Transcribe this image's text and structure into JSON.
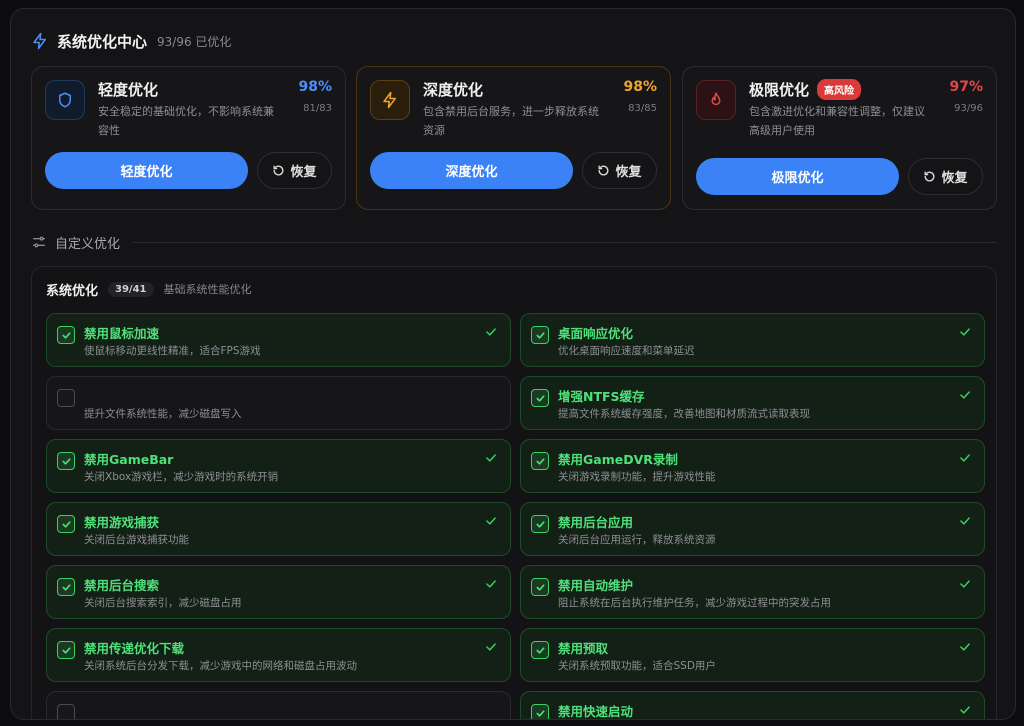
{
  "header": {
    "title": "系统优化中心",
    "status": "93/96 已优化"
  },
  "cards": [
    {
      "title": "轻度优化",
      "badge": "",
      "desc": "安全稳定的基础优化，不影响系统兼容性",
      "percent": "98%",
      "count": "81/83",
      "action": "轻度优化",
      "restore": "恢复",
      "accent": "#4c8ef7",
      "icon": "shield-icon"
    },
    {
      "title": "深度优化",
      "badge": "",
      "desc": "包含禁用后台服务，进一步释放系统资源",
      "percent": "98%",
      "count": "83/85",
      "action": "深度优化",
      "restore": "恢复",
      "accent": "#f0a330",
      "icon": "bolt-icon"
    },
    {
      "title": "极限优化",
      "badge": "高风险",
      "desc": "包含激进优化和兼容性调整，仅建议高级用户使用",
      "percent": "97%",
      "count": "93/96",
      "action": "极限优化",
      "restore": "恢复",
      "accent": "#e04848",
      "icon": "flame-icon"
    }
  ],
  "custom": {
    "label": "自定义优化"
  },
  "section": {
    "title": "系统优化",
    "count": "39/41",
    "subtitle": "基础系统性能优化"
  },
  "options": [
    {
      "title": "禁用鼠标加速",
      "desc": "使鼠标移动更线性精准，适合FPS游戏",
      "checked": true
    },
    {
      "title": "桌面响应优化",
      "desc": "优化桌面响应速度和菜单延迟",
      "checked": true
    },
    {
      "title": "",
      "desc": "提升文件系统性能，减少磁盘写入",
      "checked": false
    },
    {
      "title": "增强NTFS缓存",
      "desc": "提高文件系统缓存强度，改善地图和材质流式读取表现",
      "checked": true
    },
    {
      "title": "禁用GameBar",
      "desc": "关闭Xbox游戏栏，减少游戏时的系统开销",
      "checked": true
    },
    {
      "title": "禁用GameDVR录制",
      "desc": "关闭游戏录制功能，提升游戏性能",
      "checked": true
    },
    {
      "title": "禁用游戏捕获",
      "desc": "关闭后台游戏捕获功能",
      "checked": true
    },
    {
      "title": "禁用后台应用",
      "desc": "关闭后台应用运行，释放系统资源",
      "checked": true
    },
    {
      "title": "禁用后台搜索",
      "desc": "关闭后台搜索索引，减少磁盘占用",
      "checked": true
    },
    {
      "title": "禁用自动维护",
      "desc": "阻止系统在后台执行维护任务，减少游戏过程中的突发占用",
      "checked": true
    },
    {
      "title": "禁用传递优化下载",
      "desc": "关闭系统后台分发下载，减少游戏中的网络和磁盘占用波动",
      "checked": true
    },
    {
      "title": "禁用预取",
      "desc": "关闭系统预取功能，适合SSD用户",
      "checked": true
    },
    {
      "title": "",
      "desc": "",
      "checked": false
    },
    {
      "title": "禁用快速启动",
      "desc": "",
      "checked": true
    }
  ]
}
